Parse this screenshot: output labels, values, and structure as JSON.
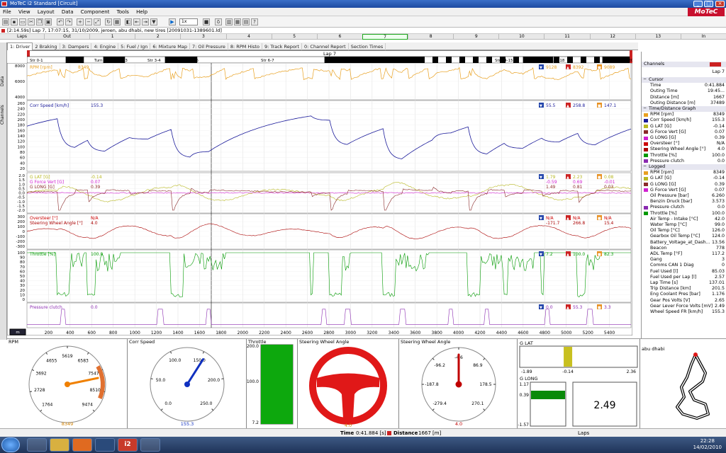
{
  "window": {
    "title": "MoTeC i2 Standard [Circuit]"
  },
  "menu": [
    "File",
    "View",
    "Layout",
    "Data",
    "Component",
    "Tools",
    "Help"
  ],
  "brand": "MoTeC",
  "toolbar": {
    "zoom": "1x"
  },
  "info": "[2:14.59s] Lap 7, 17:07:15, 31/10/2009, jeroen, abu dhabi, new tires [20091031-1389601.ld]",
  "laps": {
    "label": "Laps",
    "cells": [
      "Out",
      "1",
      "2",
      "3",
      "4",
      "5",
      "6",
      "7",
      "8",
      "9",
      "10",
      "11",
      "12",
      "13",
      "In"
    ]
  },
  "tabs": [
    "1: Driver",
    "2 Braking",
    "3: Dampers",
    "4: Engine",
    "5: Fuel / Ign",
    "6: Mixture Map",
    "7: Oil Pressure",
    "8: RPM Histo",
    "9: Track Report",
    "0: Channel Report",
    "Section Times"
  ],
  "sidetabs": [
    "Data",
    "Channels"
  ],
  "track_sections": {
    "lap": "Lap 7",
    "sections": [
      "Str 0-1",
      "Turn 1",
      "Turn 2",
      "Turn 3",
      "Str 3-4",
      "Turn 6",
      "Str 6-7",
      "Str 9-10",
      "Str 14-15",
      "Turn 18",
      "Turn 20"
    ]
  },
  "panes": {
    "rpm": {
      "label": "RPM [rpm]",
      "value": "8349",
      "stats": [
        "9128",
        "8392",
        "9089"
      ],
      "ticks": [
        "8000",
        "6000",
        "4000"
      ]
    },
    "speed": {
      "label": "Corr Speed [km/h]",
      "value": "155.3",
      "stats": [
        "55.5",
        "258.8",
        "147.1"
      ],
      "ticks": [
        "260",
        "240",
        "220",
        "200",
        "180",
        "160",
        "140",
        "120",
        "100",
        "80",
        "60",
        "40",
        "20"
      ]
    },
    "gforce": {
      "labels": [
        "G LAT [G]",
        "G Force Vert [G]",
        "G LONG [G]"
      ],
      "values": [
        "-0.14",
        "0.07",
        "0.39"
      ],
      "stats": [
        [
          "1.79",
          "-0.59",
          "1.49"
        ],
        [
          "2.23",
          "0.69",
          "0.81"
        ],
        [
          "0.08",
          "-0.01",
          "0.03"
        ]
      ],
      "ticks": [
        "2.0",
        "1.5",
        "1.0",
        "0.5",
        "0.0",
        "-0.5",
        "-1.0",
        "-1.5",
        "-2.0"
      ]
    },
    "steer": {
      "labels": [
        "Oversteer [°]",
        "Steering Wheel Angle [°]"
      ],
      "values": [
        "N/A",
        "4.0"
      ],
      "stats": [
        [
          "N/A",
          "-171.7"
        ],
        [
          "N/A",
          "266.8"
        ],
        [
          "N/A",
          "15.4"
        ]
      ],
      "ticks": [
        "300",
        "200",
        "100",
        "0",
        "-100",
        "-200",
        "-300"
      ]
    },
    "throttle": {
      "label": "Throttle [%]",
      "value": "100.0",
      "stats": [
        "7.2",
        "100.0",
        "82.3"
      ],
      "ticks": [
        "100",
        "90",
        "80",
        "70",
        "60",
        "50",
        "40",
        "30",
        "20",
        "10",
        "0"
      ]
    },
    "clutch": {
      "label": "Pressure clutch",
      "value": "0.0",
      "stats": [
        "0.0",
        "55.3",
        "3.3"
      ]
    },
    "xaxis": {
      "ticks": [
        "200",
        "400",
        "600",
        "800",
        "1000",
        "1200",
        "1400",
        "1600",
        "1800",
        "2000",
        "2200",
        "2400",
        "2600",
        "2800",
        "3000",
        "3200",
        "3400",
        "3600",
        "3800",
        "4000",
        "4200",
        "4400",
        "4600",
        "4800",
        "5000",
        "5200",
        "5400"
      ],
      "unit": "m"
    }
  },
  "right_panel": {
    "title": "Channels",
    "lap": "Lap 7",
    "cursor": {
      "header": "Cursor",
      "rows": [
        [
          "Time",
          "0:41.884"
        ],
        [
          "Outing Time",
          "19:45..."
        ],
        [
          "Distance [m]",
          "1667"
        ],
        [
          "Outing Distance [m]",
          "37489"
        ]
      ]
    },
    "graph": {
      "header": "Time/Distance Graph",
      "rows": [
        [
          "RPM [rpm]",
          "8349"
        ],
        [
          "Corr Speed [km/h]",
          "155.3"
        ],
        [
          "G LAT [G]",
          "-0.14"
        ],
        [
          "G Force Vert [G]",
          "0.07"
        ],
        [
          "G LONG [G]",
          "0.39"
        ],
        [
          "Oversteer [°]",
          "N/A"
        ],
        [
          "Steering Wheel Angle [°]",
          "4.0"
        ],
        [
          "Throttle [%]",
          "100.0"
        ],
        [
          "Pressure clutch",
          "0.0"
        ]
      ]
    },
    "logged": {
      "header": "Logged",
      "rows": [
        [
          "RPM [rpm]",
          "8349"
        ],
        [
          "G LAT [G]",
          "-0.14"
        ],
        [
          "G LONG [G]",
          "0.39"
        ],
        [
          "G Force Vert [G]",
          "0.07"
        ],
        [
          "Oil Pressure [bar]",
          "6.260"
        ],
        [
          "Benzin Druck [bar]",
          "3.573"
        ],
        [
          "Pressure clutch",
          "0.0"
        ],
        [
          "Throttle [%]",
          "100.0"
        ],
        [
          "Air Temp - Intake [°C]",
          "42.0"
        ],
        [
          "Water Temp [°C]",
          "99.0"
        ],
        [
          "Oil Temp [°C]",
          "126.0"
        ],
        [
          "Gearbox Oil Temp [°C]",
          "124.0"
        ],
        [
          "Battery_Voltage_at_Dash...",
          "13.56"
        ],
        [
          "Beacon",
          "778"
        ],
        [
          "ADL Temp [°F]",
          "117.2"
        ],
        [
          "Gang",
          "3"
        ],
        [
          "Comms CAN 1 Diag",
          "0"
        ],
        [
          "Fuel Used [l]",
          "85.03"
        ],
        [
          "Fuel Used per Lap [l]",
          "2.57"
        ],
        [
          "Lap Time [s]",
          "137.01"
        ],
        [
          "Trip Distance [km]",
          "201.5"
        ],
        [
          "Eng Coolant Pres [bar]",
          "1.176"
        ],
        [
          "Gear Pos Volts [V]",
          "2.65"
        ],
        [
          "Gear Lever Force Volts [mV]",
          "2.49"
        ],
        [
          "Wheel Speed FR [km/h]",
          "155.3"
        ]
      ]
    },
    "colors": [
      "#e8a020",
      "#1a1a9a",
      "#b8b820",
      "#8a2a2a",
      "#d020d0",
      "#cc0000",
      "#aa0000",
      "#009900",
      "#8a2ab0"
    ]
  },
  "gauges": {
    "rpm": {
      "title": "RPM",
      "ticks": [
        "1764",
        "2728",
        "3692",
        "4655",
        "5619",
        "6583",
        "7547",
        "8510",
        "9474"
      ],
      "value": "8349",
      "fraction": 0.79
    },
    "speed": {
      "title": "Corr Speed",
      "ticks": [
        "0.0",
        "50.0",
        "100.0",
        "150.0",
        "200.0",
        "250.0"
      ],
      "value": "155.3",
      "fraction": 0.62
    },
    "throttle": {
      "title": "Throttle",
      "ticks": [
        "200.0",
        "100.0",
        "7.2"
      ],
      "value": "100.0",
      "fraction": 0.5
    },
    "wheel": {
      "title": "Steering Wheel Angle",
      "value": "4.0"
    },
    "steer": {
      "title": "Steering Wheel Angle",
      "ticks": [
        "-279.4",
        "-187.8",
        "-96.2",
        "-4.6",
        "86.9",
        "178.5",
        "270.1"
      ],
      "value": "4.0",
      "fraction": 0.5
    },
    "glat": {
      "title": "G LAT",
      "min": "-1.89",
      "value": "-0.14",
      "max": "2.36",
      "fraction": 0.41
    },
    "glong": {
      "title": "G LONG",
      "max": "1.17",
      "value": "0.39",
      "min": "-1.57",
      "fraction": 0.71
    },
    "lapnum": "2.49",
    "track": {
      "title": "abu dhabi"
    }
  },
  "status": {
    "time_label": "Time",
    "time_value": "0:41.884 [s]",
    "dist_label": "Distance",
    "dist_value": "1667 [m]",
    "laps": "Laps"
  },
  "clock": {
    "time": "22:28",
    "date": "14/02/2010"
  }
}
